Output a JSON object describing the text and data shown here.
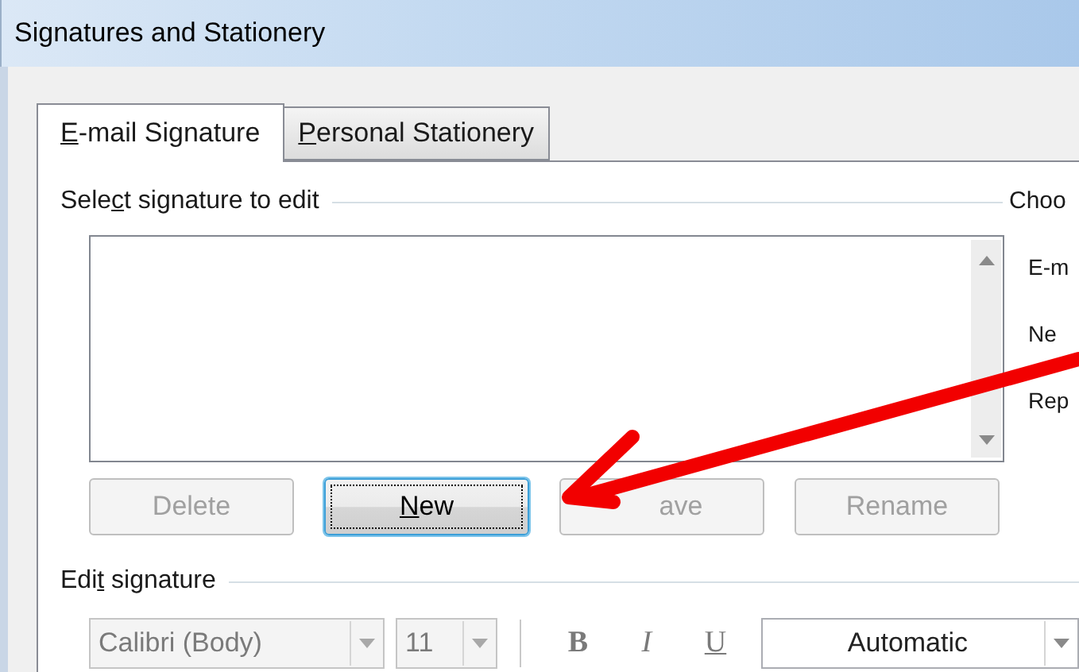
{
  "window": {
    "title": "Signatures and Stationery"
  },
  "tabs": [
    {
      "key": "E",
      "after": "-mail Signature",
      "selected": true
    },
    {
      "key": "P",
      "after": "ersonal Stationery",
      "selected": false
    }
  ],
  "select_group": {
    "before": "Sele",
    "key": "c",
    "after": "t signature to edit"
  },
  "buttons": [
    {
      "before": "Delete",
      "disabled": true,
      "focused": false
    },
    {
      "key": "N",
      "after": "ew",
      "disabled": false,
      "focused": true
    },
    {
      "before": "ave",
      "disabled": true,
      "focused": false
    },
    {
      "before": "Rename",
      "disabled": true,
      "focused": false
    }
  ],
  "right_group": {
    "heading": "Choo",
    "labels": [
      "E-m",
      "Ne",
      "Rep"
    ]
  },
  "edit_group": {
    "before": "Edi",
    "key": "t",
    "after": " signature"
  },
  "toolbar": {
    "font": {
      "value": "Calibri (Body)",
      "disabled": true
    },
    "size": {
      "value": "11",
      "disabled": true
    },
    "format_buttons": [
      {
        "label": "B",
        "kind": "bold"
      },
      {
        "label": "I",
        "kind": "italic"
      },
      {
        "label": "U",
        "kind": "underline"
      }
    ],
    "color": {
      "value": "Automatic",
      "disabled": false
    }
  }
}
